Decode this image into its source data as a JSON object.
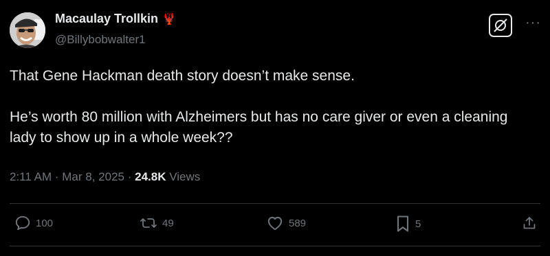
{
  "author": {
    "display_name": "Macaulay Trollkin",
    "badge_emoji": "🦞",
    "handle": "@Billybobwalter1"
  },
  "tweet": {
    "paragraphs": [
      "That Gene Hackman death story doesn’t make sense.",
      "He’s worth 80 million with Alzheimers but has no care giver or even a cleaning lady to show up in a whole week??"
    ],
    "time": "2:11 AM",
    "date": "Mar 8, 2025",
    "separator": "·",
    "views_count": "24.8K",
    "views_label": "Views"
  },
  "actions": {
    "replies": "100",
    "reposts": "49",
    "likes": "589",
    "bookmarks": "5"
  },
  "icons": {
    "grok": "grok-icon",
    "more": "more-icon",
    "reply": "reply-icon",
    "repost": "repost-icon",
    "like": "like-icon",
    "bookmark": "bookmark-icon",
    "share": "share-icon"
  },
  "colors": {
    "background": "#000000",
    "text": "#e7e9ea",
    "muted": "#71767b",
    "divider": "#2f3336"
  }
}
